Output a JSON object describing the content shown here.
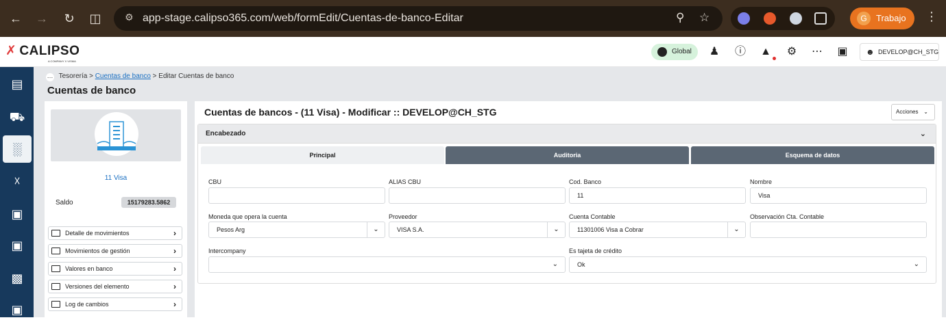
{
  "browser": {
    "url": "app-stage.calipso365.com/web/formEdit/Cuentas-de-banco-Editar",
    "profile_initial": "G",
    "profile_name": "Trabajo"
  },
  "app": {
    "logo": "CALIPSO",
    "logo_sub": "A COMPANY X VISMA",
    "global_label": "Global",
    "user": "DEVELOP@CH_STG"
  },
  "breadcrumb": {
    "root": "Tesorería",
    "parent": "Cuentas de banco",
    "current": "Editar Cuentas de banco",
    "sep": ">"
  },
  "page_title": "Cuentas de banco",
  "left": {
    "entity_name": "11 Visa",
    "saldo_label": "Saldo",
    "saldo_value": "15179283.5862",
    "links": [
      "Detalle de movimientos",
      "Movimientos de gestión",
      "Valores en banco",
      "Versiones del elemento",
      "Log de cambios"
    ]
  },
  "form": {
    "title": "Cuentas de bancos - (11 Visa) - Modificar :: DEVELOP@CH_STG",
    "acciones": "Acciones",
    "section": "Encabezado",
    "tabs": [
      "Principal",
      "Auditoria",
      "Esquema de datos"
    ],
    "fields": {
      "cbu_label": "CBU",
      "cbu_value": "",
      "alias_label": "ALIAS CBU",
      "alias_value": "",
      "codbanco_label": "Cod. Banco",
      "codbanco_value": "11",
      "nombre_label": "Nombre",
      "nombre_value": "Visa",
      "moneda_label": "Moneda que opera la cuenta",
      "moneda_value": "Pesos Arg",
      "proveedor_label": "Proveedor",
      "proveedor_value": "VISA S.A.",
      "cuenta_label": "Cuenta Contable",
      "cuenta_value": "11301006 Visa a Cobrar",
      "obs_label": "Observación Cta. Contable",
      "obs_value": "",
      "interco_label": "Intercompany",
      "interco_value": "",
      "tarjeta_label": "Es tajeta de crédito",
      "tarjeta_value": "Ok"
    }
  },
  "colors": {
    "sidebar": "#17395c",
    "link": "#1a6fc2",
    "global": "#d6f2dc",
    "profile": "#e8731f"
  }
}
